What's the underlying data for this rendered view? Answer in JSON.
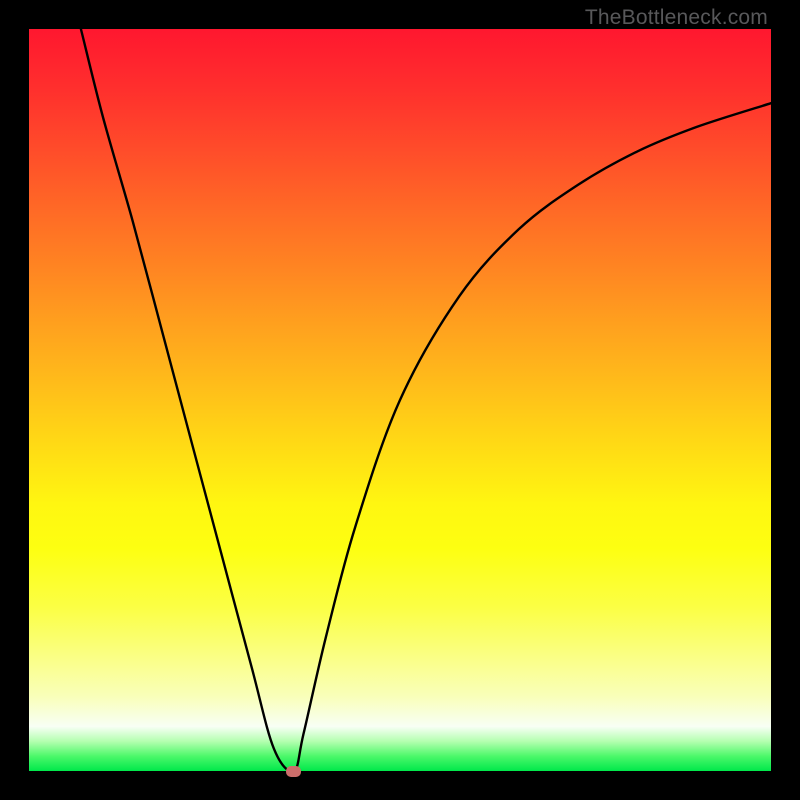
{
  "attribution": "TheBottleneck.com",
  "chart_data": {
    "type": "line",
    "title": "",
    "xlabel": "",
    "ylabel": "",
    "xlim": [
      0,
      100
    ],
    "ylim": [
      0,
      100
    ],
    "series": [
      {
        "name": "bottleneck-curve",
        "x": [
          7.0,
          10,
          14,
          18,
          22,
          26,
          30,
          33,
          35.7,
          37,
          40,
          44,
          50,
          58,
          66,
          74,
          82,
          90,
          100
        ],
        "y": [
          100,
          88,
          74,
          59,
          44,
          29,
          14,
          3,
          0,
          5,
          18,
          33,
          50,
          64,
          73,
          79,
          83.5,
          86.8,
          90
        ]
      }
    ],
    "marker": {
      "x": 35.7,
      "y": 0,
      "color": "#cb6e6b"
    },
    "background_gradient": {
      "top": "#ff172f",
      "bottom": "#00e84b"
    }
  }
}
